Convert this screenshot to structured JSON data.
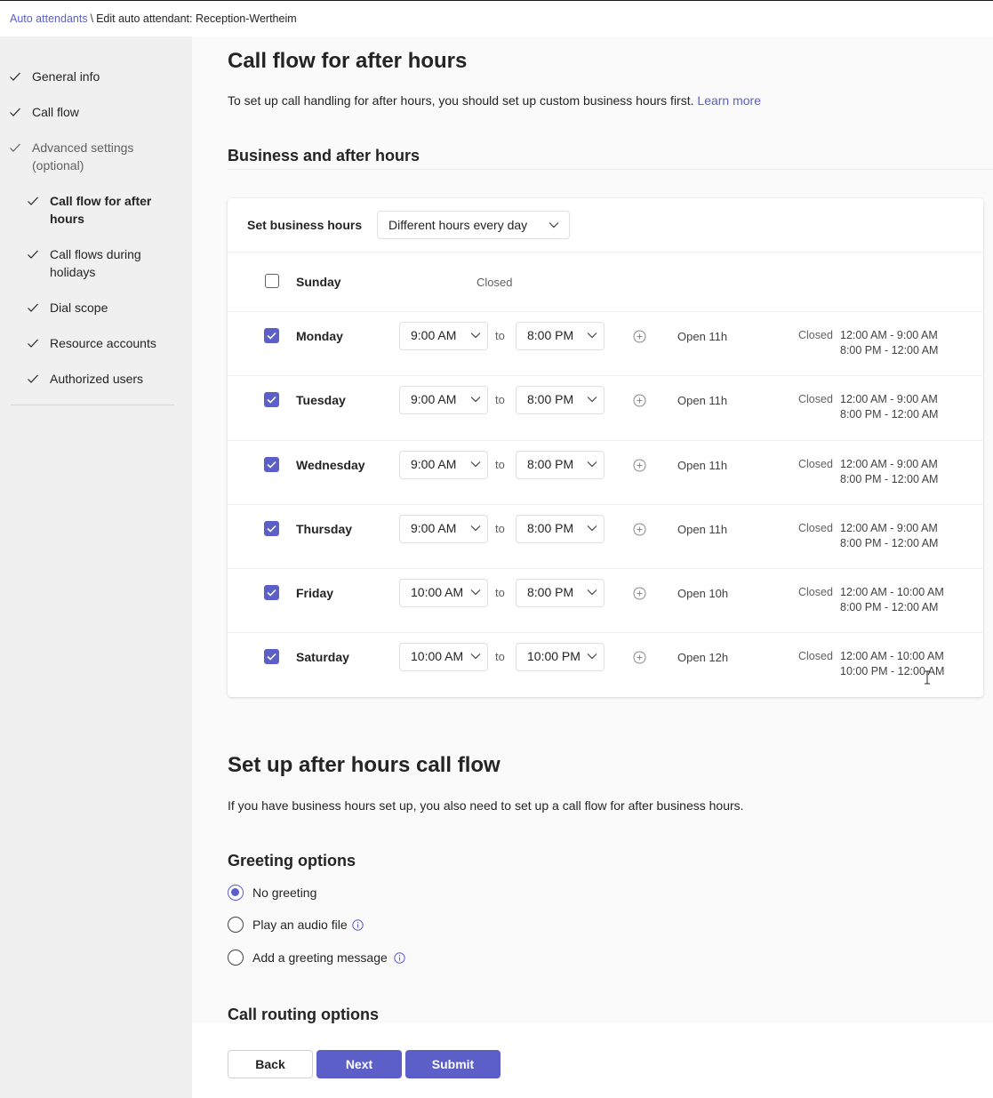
{
  "breadcrumb": {
    "link": "Auto attendants",
    "separator": "\\",
    "current": "Edit auto attendant: Reception-Wertheim"
  },
  "sidebar": {
    "items": [
      {
        "label": "General info"
      },
      {
        "label": "Call flow"
      },
      {
        "label": "Advanced settings (optional)"
      },
      {
        "label": "Call flow for after hours"
      },
      {
        "label": "Call flows during holidays"
      },
      {
        "label": "Dial scope"
      },
      {
        "label": "Resource accounts"
      },
      {
        "label": "Authorized users"
      }
    ]
  },
  "page": {
    "title": "Call flow for after hours",
    "intro": "To set up call handling for after hours, you should set up custom business hours first.",
    "learn_more": "Learn more",
    "business_section_title": "Business and after hours"
  },
  "business_hours": {
    "set_label": "Set business hours",
    "mode": "Different hours every day",
    "to_label": "to",
    "closed_label": "Closed",
    "days": [
      {
        "name": "Sunday",
        "checked": false,
        "status": "Closed"
      },
      {
        "name": "Monday",
        "checked": true,
        "start": "9:00 AM",
        "end": "8:00 PM",
        "open": "Open 11h",
        "closed1": "12:00 AM - 9:00 AM",
        "closed2": "8:00 PM - 12:00 AM"
      },
      {
        "name": "Tuesday",
        "checked": true,
        "start": "9:00 AM",
        "end": "8:00 PM",
        "open": "Open 11h",
        "closed1": "12:00 AM - 9:00 AM",
        "closed2": "8:00 PM - 12:00 AM"
      },
      {
        "name": "Wednesday",
        "checked": true,
        "start": "9:00 AM",
        "end": "8:00 PM",
        "open": "Open 11h",
        "closed1": "12:00 AM - 9:00 AM",
        "closed2": "8:00 PM - 12:00 AM"
      },
      {
        "name": "Thursday",
        "checked": true,
        "start": "9:00 AM",
        "end": "8:00 PM",
        "open": "Open 11h",
        "closed1": "12:00 AM - 9:00 AM",
        "closed2": "8:00 PM - 12:00 AM"
      },
      {
        "name": "Friday",
        "checked": true,
        "start": "10:00 AM",
        "end": "8:00 PM",
        "open": "Open 10h",
        "closed1": "12:00 AM - 10:00 AM",
        "closed2": "8:00 PM - 12:00 AM"
      },
      {
        "name": "Saturday",
        "checked": true,
        "start": "10:00 AM",
        "end": "10:00 PM",
        "open": "Open 12h",
        "closed1": "12:00 AM - 10:00 AM",
        "closed2": "10:00 PM - 12:00 AM"
      }
    ]
  },
  "after_hours": {
    "title": "Set up after hours call flow",
    "description": "If you have business hours set up, you also need to set up a call flow for after business hours.",
    "greeting_title": "Greeting options",
    "greeting_options": [
      {
        "label": "No greeting",
        "selected": true
      },
      {
        "label": "Play an audio file",
        "selected": false
      },
      {
        "label": "Add a greeting message",
        "selected": false
      }
    ],
    "routing_title": "Call routing options"
  },
  "footer": {
    "back": "Back",
    "next": "Next",
    "submit": "Submit"
  },
  "colors": {
    "accent": "#5b5fc7",
    "sidebar_bg": "#f0f0f0"
  }
}
